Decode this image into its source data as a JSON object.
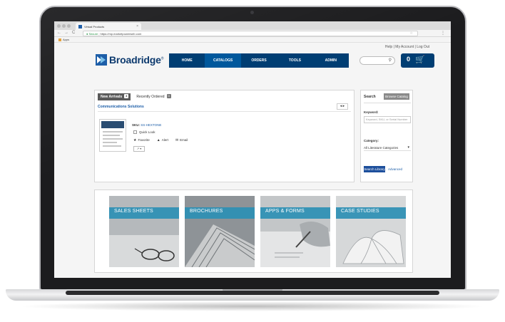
{
  "browser": {
    "tab_title": "Virtual Products",
    "tab_close": "×",
    "nav_back": "←",
    "nav_forward": "→",
    "nav_reload": "C",
    "secure_label": "Secure",
    "url": "https://mp.marketpowerweb.com",
    "star": "☆",
    "menu": "⋮",
    "bookmarks_label": "Apps"
  },
  "header": {
    "utility_links": "Help | My Account | Log Out",
    "logo_text": "Broadridge",
    "logo_mark": "®",
    "nav": [
      "HOME",
      "CATALOGS",
      "ORDERS",
      "TOOLS",
      "ADMIN"
    ],
    "active_nav_index": 1,
    "search_icon": "⚲",
    "cart_count": "0",
    "cart_icon": "🛒"
  },
  "arrivals": {
    "tabs": [
      {
        "label": "New Arrivals",
        "count": "3"
      },
      {
        "label": "Recently Ordered",
        "count": "0"
      }
    ],
    "category": "Communications Solutions",
    "pager": "◂ ▸",
    "item": {
      "sku_label": "SKU:",
      "sku_value": "SS-HEXTONE",
      "quick_look": "Quick Look",
      "favorite": "Favorite",
      "alert": "Alert",
      "email": "Email",
      "share": "↗ ▾"
    }
  },
  "search_panel": {
    "title": "Search",
    "browse_button": "Browse Catalog",
    "keyword_label": "Keyword:",
    "keyword_placeholder": "Keyword, SKU, or Serial Number",
    "category_label": "Category:",
    "category_value": "All Literature Categories",
    "category_caret": "▾",
    "search_button": "Search Library",
    "advanced_link": "Advanced"
  },
  "tiles": [
    {
      "label": "SALES SHEETS"
    },
    {
      "label": "BROCHURES"
    },
    {
      "label": "APPS & FORMS"
    },
    {
      "label": "CASE STUDIES"
    }
  ],
  "colors": {
    "nav_bg": "#003e73",
    "nav_active": "#00589c",
    "tile_stripe": "#2d8fb4",
    "link": "#1d5ea8"
  }
}
